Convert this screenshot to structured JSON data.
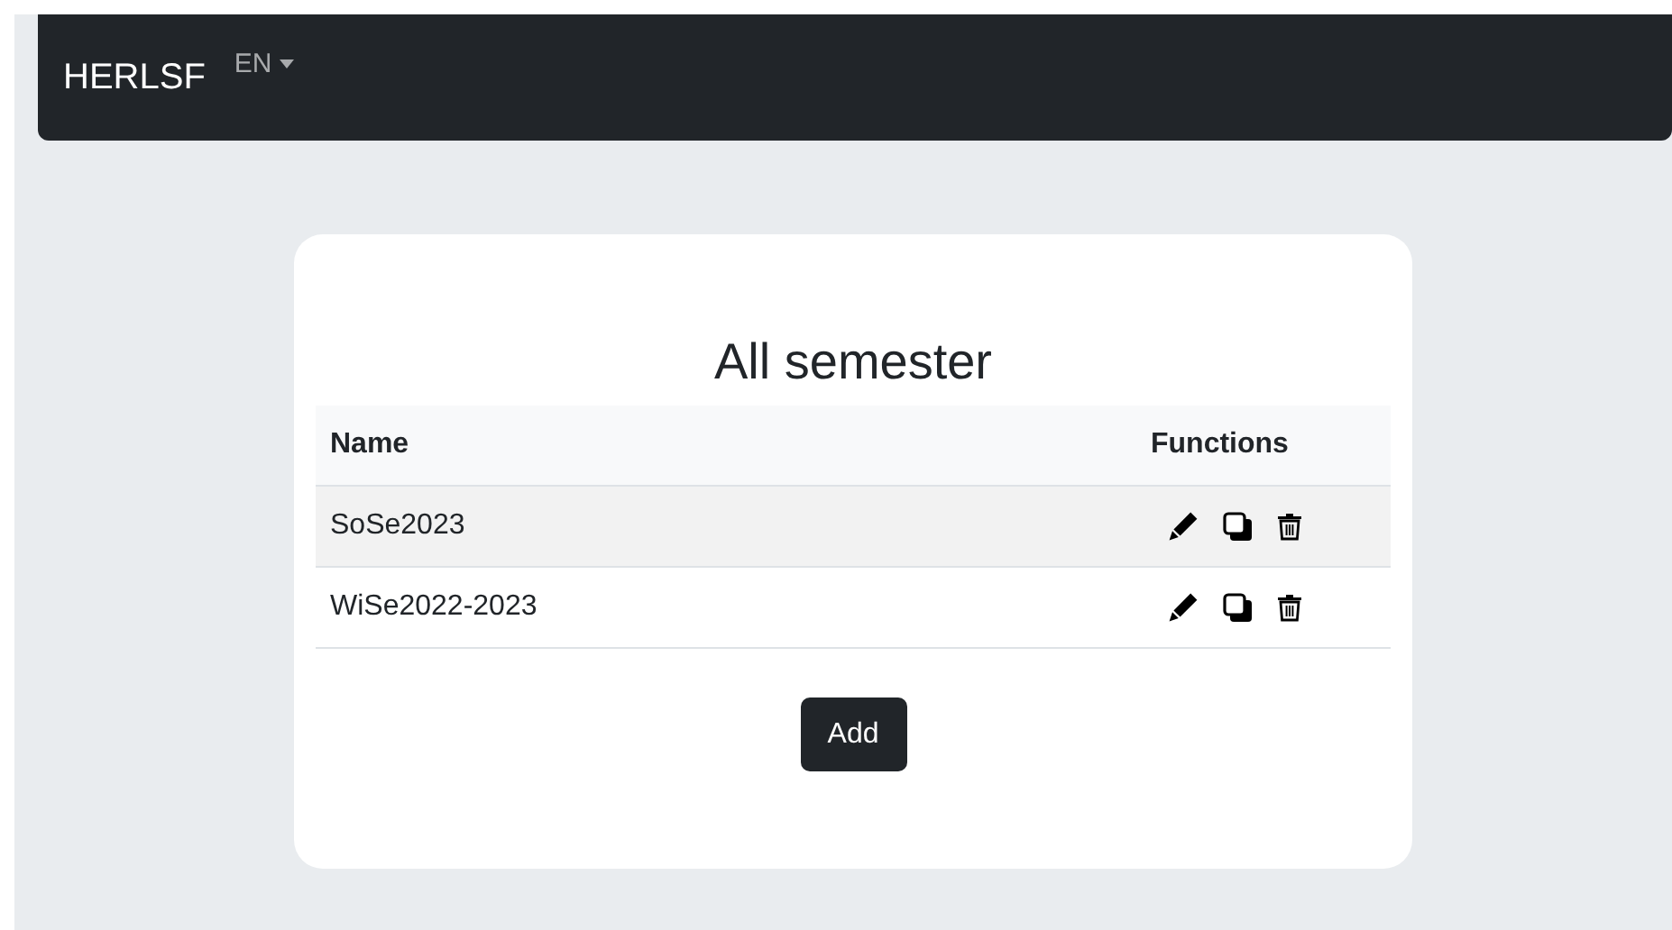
{
  "navbar": {
    "brand": "HERLSF",
    "language": "EN"
  },
  "card": {
    "title": "All semester",
    "table": {
      "columns": [
        "Name",
        "Functions"
      ],
      "rows": [
        {
          "name": "SoSe2023"
        },
        {
          "name": "WiSe2022-2023"
        }
      ]
    },
    "add_button": "Add"
  }
}
